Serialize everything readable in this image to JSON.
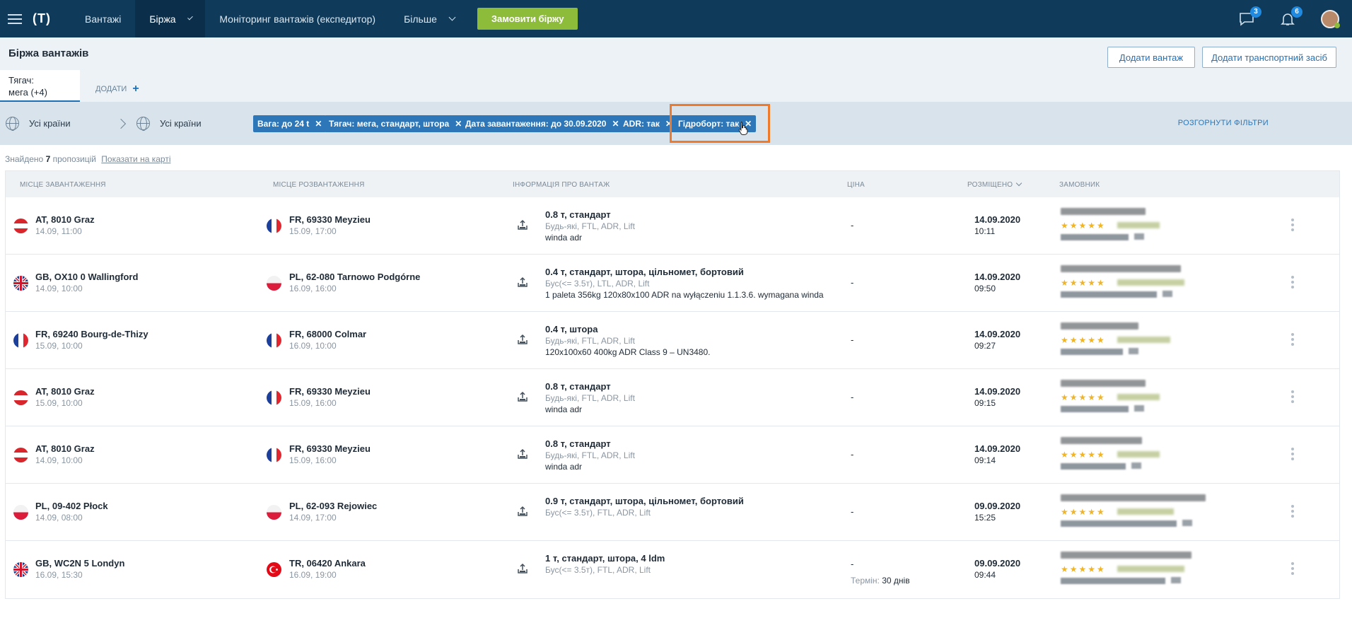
{
  "nav": {
    "items": [
      "Вантажі",
      "Біржа",
      "Моніторинг вантажів (експедитор)",
      "Більше"
    ],
    "order_button": "Замовити біржу",
    "messages_count": "3",
    "notifications_count": "6"
  },
  "header": {
    "title": "Біржа вантажів",
    "add_cargo": "Додати вантаж",
    "add_vehicle": "Додати транспортний засіб",
    "saved_tab_line1": "Тягач:",
    "saved_tab_line2": "мега (+4)",
    "add_tab": "ДОДАТИ"
  },
  "filters": {
    "from": "Усі країни",
    "to": "Усі країни",
    "chips": [
      "Вага: до 24 t",
      "Тягач: мега, стандарт, штора",
      "Дата завантаження: до 30.09.2020",
      "ADR: так",
      "Гідроборт: так"
    ],
    "expand": "РОЗГОРНУТИ ФІЛЬТРИ"
  },
  "found": {
    "prefix": "Знайдено",
    "count": "7",
    "suffix": "пропозицій",
    "map_link": "Показати на карті"
  },
  "columns": {
    "loading": "МІСЦЕ ЗАВАНТАЖЕННЯ",
    "unloading": "МІСЦЕ РОЗВАНТАЖЕННЯ",
    "info": "ІНФОРМАЦІЯ ПРО ВАНТАЖ",
    "price": "ЦІНА",
    "posted": "РОЗМІЩЕНО",
    "customer": "ЗАМОВНИК"
  },
  "rows": [
    {
      "from_flag": "AT",
      "from": "AT, 8010 Graz",
      "from_date": "14.09, 11:00",
      "to_flag": "FR",
      "to": "FR, 69330 Meyzieu",
      "to_date": "15.09, 17:00",
      "title": "0.8 т, стандарт",
      "sub": "Будь-які, FTL, ADR, Lift",
      "note": "winda adr",
      "price": "-",
      "price_note": "",
      "price_days": "",
      "date": "14.09.2020",
      "time": "10:11"
    },
    {
      "from_flag": "GB",
      "from": "GB, OX10 0 Wallingford",
      "from_date": "14.09, 10:00",
      "to_flag": "PL",
      "to": "PL, 62-080 Tarnowo Podgórne",
      "to_date": "16.09, 16:00",
      "title": "0.4 т, стандарт, штора, цільномет, бортовий",
      "sub": "Бус(<= 3.5т), LTL, ADR, Lift",
      "note": "1 paleta 356kg 120x80x100 ADR na wyłączeniu 1.1.3.6. wymagana winda",
      "price": "-",
      "price_note": "",
      "price_days": "",
      "date": "14.09.2020",
      "time": "09:50"
    },
    {
      "from_flag": "FR",
      "from": "FR, 69240 Bourg-de-Thizy",
      "from_date": "15.09, 10:00",
      "to_flag": "FR",
      "to": "FR, 68000 Colmar",
      "to_date": "16.09, 10:00",
      "title": "0.4 т, штора",
      "sub": "Будь-які, FTL, ADR, Lift",
      "note": "120x100x60 400kg ADR Class 9 – UN3480.",
      "price": "-",
      "price_note": "",
      "price_days": "",
      "date": "14.09.2020",
      "time": "09:27"
    },
    {
      "from_flag": "AT",
      "from": "AT, 8010 Graz",
      "from_date": "15.09, 10:00",
      "to_flag": "FR",
      "to": "FR, 69330 Meyzieu",
      "to_date": "15.09, 16:00",
      "title": "0.8 т, стандарт",
      "sub": "Будь-які, FTL, ADR, Lift",
      "note": "winda adr",
      "price": "-",
      "price_note": "",
      "price_days": "",
      "date": "14.09.2020",
      "time": "09:15"
    },
    {
      "from_flag": "AT",
      "from": "AT, 8010 Graz",
      "from_date": "14.09, 10:00",
      "to_flag": "FR",
      "to": "FR, 69330 Meyzieu",
      "to_date": "15.09, 16:00",
      "title": "0.8 т, стандарт",
      "sub": "Будь-які, FTL, ADR, Lift",
      "note": "winda adr",
      "price": "-",
      "price_note": "",
      "price_days": "",
      "date": "14.09.2020",
      "time": "09:14"
    },
    {
      "from_flag": "PL",
      "from": "PL, 09-402 Płock",
      "from_date": "14.09, 08:00",
      "to_flag": "PL",
      "to": "PL, 62-093 Rejowiec",
      "to_date": "14.09, 17:00",
      "title": "0.9 т, стандарт, штора, цільномет, бортовий",
      "sub": "Бус(<= 3.5т), FTL, ADR, Lift",
      "note": "",
      "price": "-",
      "price_note": "",
      "price_days": "",
      "date": "09.09.2020",
      "time": "15:25"
    },
    {
      "from_flag": "GB",
      "from": "GB, WC2N 5 Londyn",
      "from_date": "16.09, 15:30",
      "to_flag": "TR",
      "to": "TR, 06420 Ankara",
      "to_date": "16.09, 19:00",
      "title": "1 т, стандарт, штора, 4 ldm",
      "sub": "Бус(<= 3.5т), FTL, ADR, Lift",
      "note": "",
      "price": "-",
      "price_note": "Термін:",
      "price_days": "30 днів",
      "date": "09.09.2020",
      "time": "09:44"
    }
  ],
  "colors": {
    "nav_bg": "#0f3a5a",
    "accent_green": "#8dbc3a",
    "chip_blue": "#2d77b8",
    "highlight_orange": "#f07a2b",
    "star": "#f0b429"
  }
}
